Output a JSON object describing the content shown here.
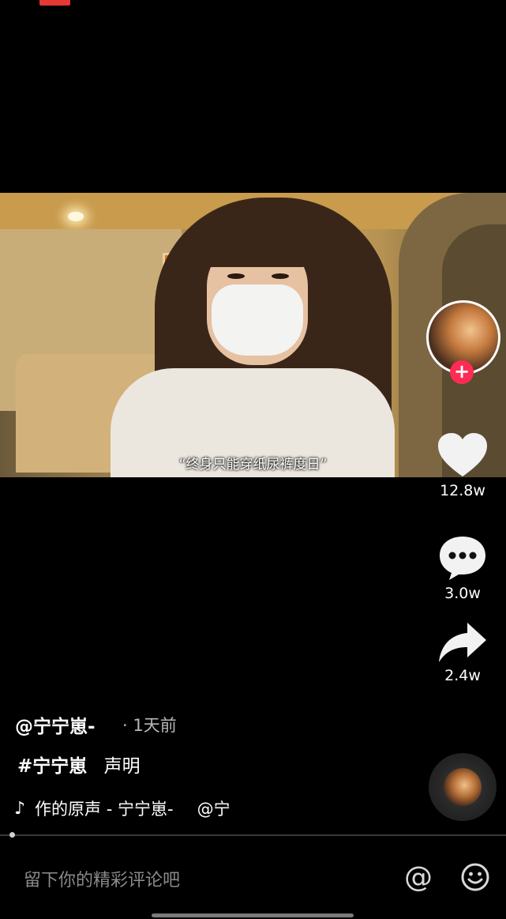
{
  "video": {
    "subtitle": "“终身只能穿纸尿裤度日”"
  },
  "actions": {
    "like_count": "12.8w",
    "comment_count": "3.0w",
    "share_count": "2.4w",
    "follow_symbol": "+"
  },
  "post": {
    "author": "@宁宁崽-",
    "time": "· 1天前",
    "hashtag": "#宁宁崽",
    "caption_text": "声明",
    "music_note": "♪",
    "music_title": "作的原声 - 宁宁崽-",
    "music_mention": "@宁"
  },
  "comment_bar": {
    "placeholder": "留下你的精彩评论吧",
    "at_symbol": "@"
  },
  "colors": {
    "accent": "#fe2c55",
    "background": "#000000"
  },
  "icons": [
    "heart-icon",
    "comment-icon",
    "share-icon",
    "music-note-icon",
    "at-icon",
    "emoji-icon"
  ]
}
